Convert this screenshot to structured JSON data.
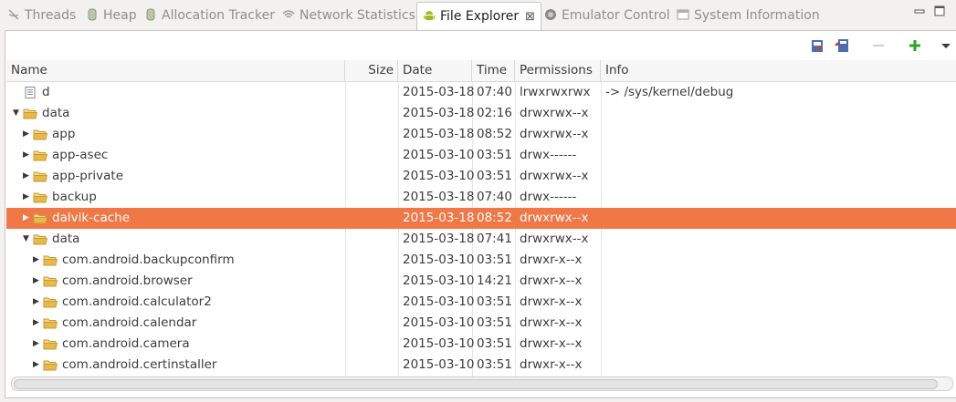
{
  "tabs": [
    {
      "label": "Threads",
      "icon": "threads-icon",
      "active": false
    },
    {
      "label": "Heap",
      "icon": "heap-icon",
      "active": false
    },
    {
      "label": "Allocation Tracker",
      "icon": "allocation-icon",
      "active": false
    },
    {
      "label": "Network Statistics",
      "icon": "network-icon",
      "active": false
    },
    {
      "label": "File Explorer",
      "icon": "android-icon",
      "active": true
    },
    {
      "label": "Emulator Control",
      "icon": "emulator-icon",
      "active": false
    },
    {
      "label": "System Information",
      "icon": "system-info-icon",
      "active": false
    }
  ],
  "tab_close_glyph": "⊠",
  "toolbar": {
    "pull_icon": "pull-file-icon",
    "push_icon": "push-file-icon",
    "delete_icon": "delete-icon",
    "new_folder_icon": "new-folder-icon",
    "menu_icon": "view-menu-icon"
  },
  "columns": {
    "name": "Name",
    "size": "Size",
    "date": "Date",
    "time": "Time",
    "permissions": "Permissions",
    "info": "Info"
  },
  "rows": [
    {
      "name": "d",
      "type": "file",
      "expander": "",
      "depth": 0,
      "date": "2015-03-18",
      "time": "07:40",
      "perm": "lrwxrwxrwx",
      "info": "-> /sys/kernel/debug"
    },
    {
      "name": "data",
      "type": "folder",
      "expander": "▼",
      "depth": 0,
      "date": "2015-03-18",
      "time": "02:16",
      "perm": "drwxrwx--x",
      "info": ""
    },
    {
      "name": "app",
      "type": "folder",
      "expander": "▶",
      "depth": 1,
      "date": "2015-03-18",
      "time": "08:52",
      "perm": "drwxrwx--x",
      "info": ""
    },
    {
      "name": "app-asec",
      "type": "folder",
      "expander": "▶",
      "depth": 1,
      "date": "2015-03-10",
      "time": "03:51",
      "perm": "drwx------",
      "info": ""
    },
    {
      "name": "app-private",
      "type": "folder",
      "expander": "▶",
      "depth": 1,
      "date": "2015-03-10",
      "time": "03:51",
      "perm": "drwxrwx--x",
      "info": ""
    },
    {
      "name": "backup",
      "type": "folder",
      "expander": "▶",
      "depth": 1,
      "date": "2015-03-18",
      "time": "07:40",
      "perm": "drwx------",
      "info": ""
    },
    {
      "name": "dalvik-cache",
      "type": "folder",
      "expander": "▶",
      "depth": 1,
      "date": "2015-03-18",
      "time": "08:52",
      "perm": "drwxrwx--x",
      "info": "",
      "selected": true
    },
    {
      "name": "data",
      "type": "folder",
      "expander": "▼",
      "depth": 1,
      "date": "2015-03-18",
      "time": "07:41",
      "perm": "drwxrwx--x",
      "info": ""
    },
    {
      "name": "com.android.backupconfirm",
      "type": "folder",
      "expander": "▶",
      "depth": 2,
      "date": "2015-03-10",
      "time": "03:51",
      "perm": "drwxr-x--x",
      "info": ""
    },
    {
      "name": "com.android.browser",
      "type": "folder",
      "expander": "▶",
      "depth": 2,
      "date": "2015-03-10",
      "time": "14:21",
      "perm": "drwxr-x--x",
      "info": ""
    },
    {
      "name": "com.android.calculator2",
      "type": "folder",
      "expander": "▶",
      "depth": 2,
      "date": "2015-03-10",
      "time": "03:51",
      "perm": "drwxr-x--x",
      "info": ""
    },
    {
      "name": "com.android.calendar",
      "type": "folder",
      "expander": "▶",
      "depth": 2,
      "date": "2015-03-10",
      "time": "03:51",
      "perm": "drwxr-x--x",
      "info": ""
    },
    {
      "name": "com.android.camera",
      "type": "folder",
      "expander": "▶",
      "depth": 2,
      "date": "2015-03-10",
      "time": "03:51",
      "perm": "drwxr-x--x",
      "info": ""
    },
    {
      "name": "com.android.certinstaller",
      "type": "folder",
      "expander": "▶",
      "depth": 2,
      "date": "2015-03-10",
      "time": "03:51",
      "perm": "drwxr-x--x",
      "info": ""
    }
  ],
  "colors": {
    "selection": "#f07746",
    "folder": "#e8b84a",
    "android": "#97c024"
  }
}
